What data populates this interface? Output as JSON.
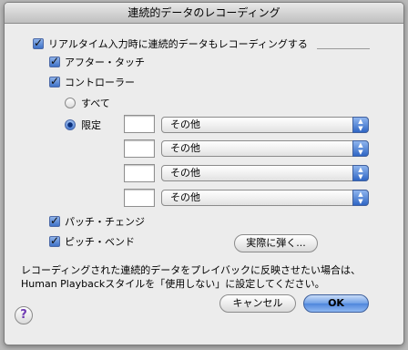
{
  "window": {
    "title": "連続的データのレコーディング"
  },
  "options": {
    "record_continuous": {
      "label": "リアルタイム入力時に連続的データもレコーディングする",
      "checked": true
    },
    "aftertouch": {
      "label": "アフター・タッチ",
      "checked": true
    },
    "controller": {
      "label": "コントローラー",
      "checked": true
    },
    "radio_all": {
      "label": "すべて",
      "selected": false
    },
    "radio_limited": {
      "label": "限定",
      "selected": true
    },
    "controller_rows": [
      {
        "number": "",
        "selection": "その他"
      },
      {
        "number": "",
        "selection": "その他"
      },
      {
        "number": "",
        "selection": "その他"
      },
      {
        "number": "",
        "selection": "その他"
      }
    ],
    "patch_change": {
      "label": "パッチ・チェンジ",
      "checked": true
    },
    "pitch_bend": {
      "label": "ピッチ・ベンド",
      "checked": true
    },
    "play_button": "実際に弾く..."
  },
  "info_text": {
    "line1": "レコーディングされた連続的データをプレイバックに反映させたい場合は、",
    "line2": "Human Playbackスタイルを「使用しない」に設定してください。"
  },
  "buttons": {
    "cancel": "キャンセル",
    "ok": "OK",
    "help": "?"
  }
}
